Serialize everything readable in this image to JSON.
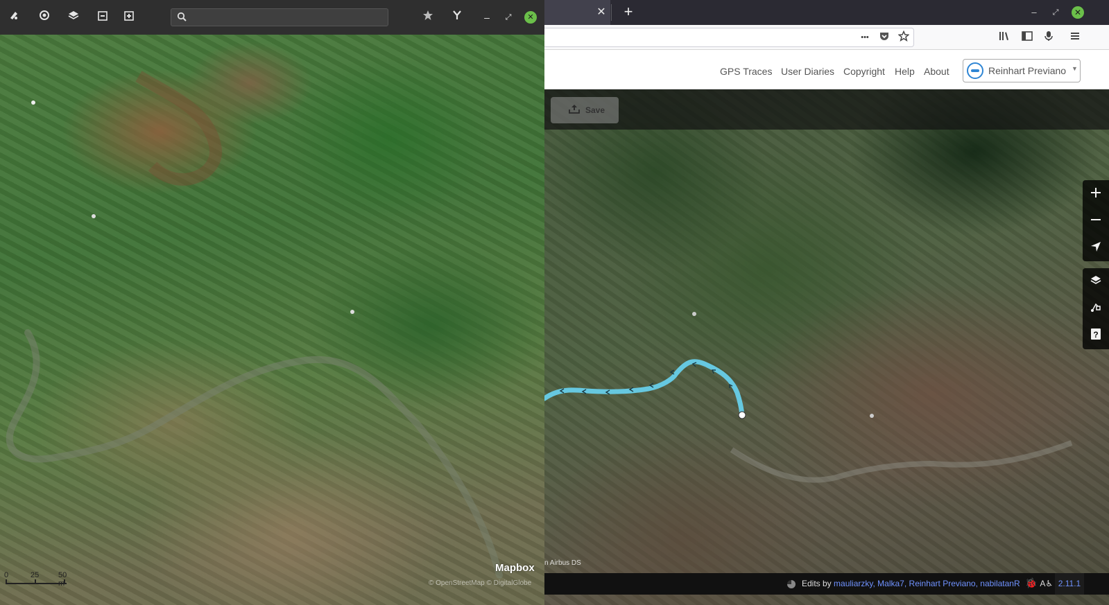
{
  "left_window": {
    "toolbar_icons": [
      "draw-icon",
      "locate-icon",
      "layers-icon",
      "zoom-out-icon",
      "zoom-in-icon"
    ],
    "search": {
      "placeholder": "",
      "value": ""
    },
    "right_icons": [
      "star-icon",
      "fork-icon"
    ],
    "window_controls": {
      "minimize": "–",
      "restore": "⤢",
      "close": "✕"
    },
    "map": {
      "logo": "Mapbox",
      "attribution": "© OpenStreetMap © DigitalGlobe",
      "scale": {
        "labels": [
          "0",
          "25",
          "50 m"
        ]
      }
    }
  },
  "browser": {
    "tab_close": "✕",
    "new_tab": "+",
    "window_controls": {
      "minimize": "–",
      "restore": "⤢",
      "close": "✕"
    },
    "nav_icons": {
      "more": "•••",
      "pocket": "⛉",
      "bookmark": "☆",
      "library": "|||\\",
      "sidebar": "▤",
      "mic": "🎤",
      "menu": "☰"
    }
  },
  "osm": {
    "nav_links": [
      "GPS Traces",
      "User Diaries",
      "Copyright",
      "Help",
      "About"
    ],
    "user": {
      "name": "Reinhart Previano"
    },
    "editor": {
      "save_label": "Save",
      "map_controls": [
        "zoom-in",
        "zoom-out",
        "geolocate",
        "background",
        "map-data",
        "help"
      ],
      "attribution": "n Airbus DS",
      "footer": {
        "edits_label": "Edits by",
        "editors": [
          "mauliarzky",
          "Malka7",
          "Reinhart Previano",
          "nabilatanR"
        ],
        "version": "2.11.1"
      }
    }
  },
  "colors": {
    "route": "#66c8e0",
    "link": "#7092ff",
    "accent_close": "#6bbf4a"
  }
}
